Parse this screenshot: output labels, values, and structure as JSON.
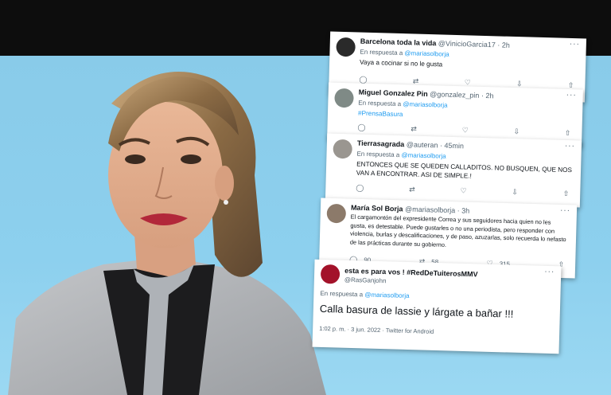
{
  "tweets": [
    {
      "name": "Barcelona toda la vida",
      "handle": "@VinicioGarcia17",
      "time": "· 2h",
      "reply_prefix": "En respuesta a",
      "reply_to": "@mariasolborja",
      "text": "Vaya a cocinar si no le gusta",
      "more": "···"
    },
    {
      "name": "Miguel Gonzalez Pin",
      "handle": "@gonzalez_pin",
      "time": "· 2h",
      "reply_prefix": "En respuesta a",
      "reply_to": "@mariasolborja",
      "text": "#PrensaBasura",
      "more": "···"
    },
    {
      "name": "Tierrasagrada",
      "handle": "@auteran",
      "time": "· 45min",
      "reply_prefix": "En respuesta a",
      "reply_to": "@mariasolborja",
      "text": "ENTONCES QUE SE QUEDEN CALLADITOS. NO BUSQUEN, QUE NOS VAN A ENCONTRAR. ASI DE SIMPLE.!",
      "more": "···"
    },
    {
      "name": "María Sol Borja",
      "handle": "@mariasolborja",
      "time": "· 3h",
      "text": "El cargamontón del expresidente Correa y sus seguidores hacia quien no les gusta, es detestable. Puede gustarles o no una periodista, pero responder con violencia, burlas y descalificaciones, y de paso, azuzarlas, solo recuerda lo nefasto de las prácticas durante su gobierno.",
      "replies": "90",
      "retweets": "58",
      "likes": "315",
      "more": "···"
    },
    {
      "name": "esta es para vos ! #RedDeTuiterosMMV",
      "handle": "@RasGanjohn",
      "reply_prefix": "En respuesta a",
      "reply_to": "@mariasolborja",
      "text": "Calla basura de lassie y lárgate a bañar !!!",
      "timestamp": "1:02 p. m. · 3 jun. 2022 · Twitter for Android",
      "more": "···"
    }
  ]
}
